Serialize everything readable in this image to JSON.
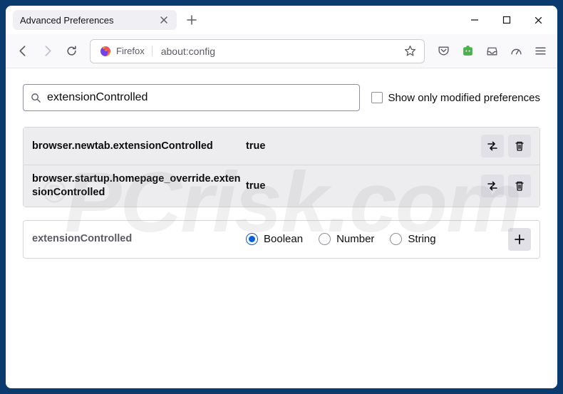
{
  "window": {
    "tab_title": "Advanced Preferences"
  },
  "urlbar": {
    "identity": "Firefox",
    "url": "about:config"
  },
  "search": {
    "value": "extensionControlled",
    "checkbox_label": "Show only modified preferences"
  },
  "prefs": [
    {
      "name": "browser.newtab.extensionControlled",
      "value": "true"
    },
    {
      "name": "browser.startup.homepage_override.extensionControlled",
      "value": "true"
    }
  ],
  "newpref": {
    "name": "extensionControlled",
    "types": [
      "Boolean",
      "Number",
      "String"
    ],
    "selected": 0
  },
  "watermark": {
    "text": "PCrisk.com",
    "reg": "®"
  }
}
